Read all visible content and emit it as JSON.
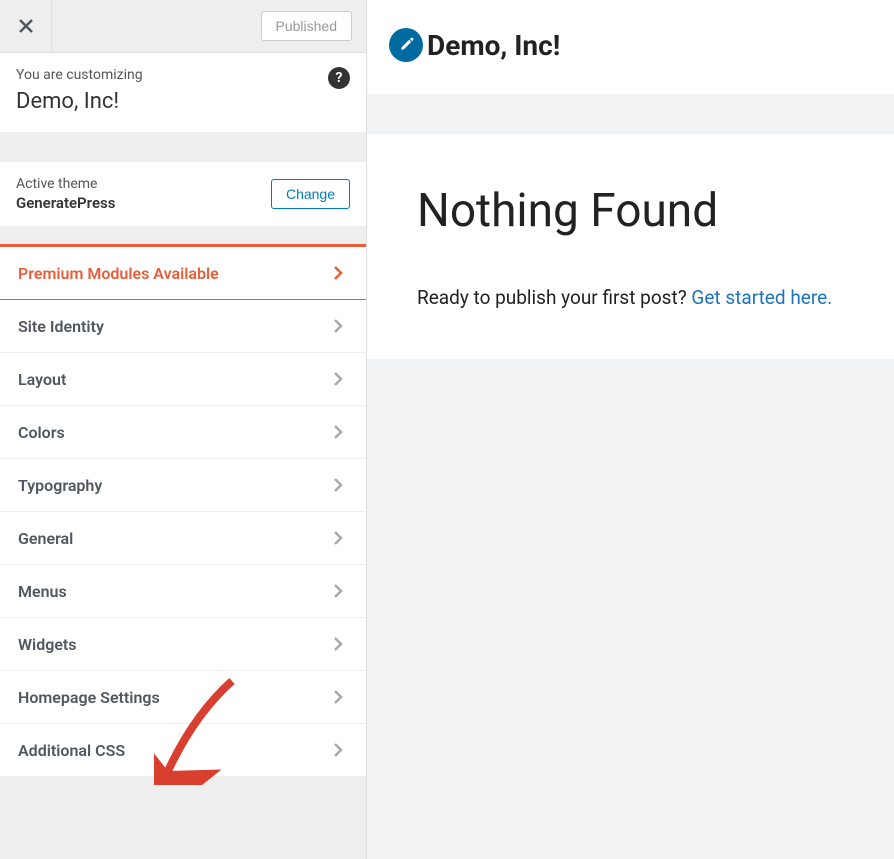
{
  "topbar": {
    "publish_label": "Published"
  },
  "info": {
    "label": "You are customizing",
    "title": "Demo, Inc!",
    "help_glyph": "?"
  },
  "theme": {
    "label": "Active theme",
    "name": "GeneratePress",
    "change_label": "Change"
  },
  "panels": [
    {
      "label": "Premium Modules Available",
      "premium": true
    },
    {
      "label": "Site Identity"
    },
    {
      "label": "Layout"
    },
    {
      "label": "Colors"
    },
    {
      "label": "Typography"
    },
    {
      "label": "General"
    },
    {
      "label": "Menus"
    },
    {
      "label": "Widgets"
    },
    {
      "label": "Homepage Settings"
    },
    {
      "label": "Additional CSS"
    }
  ],
  "preview": {
    "site_title": "Demo, Inc!",
    "heading": "Nothing Found",
    "prompt_text": "Ready to publish your first post? ",
    "link_text": "Get started here."
  }
}
